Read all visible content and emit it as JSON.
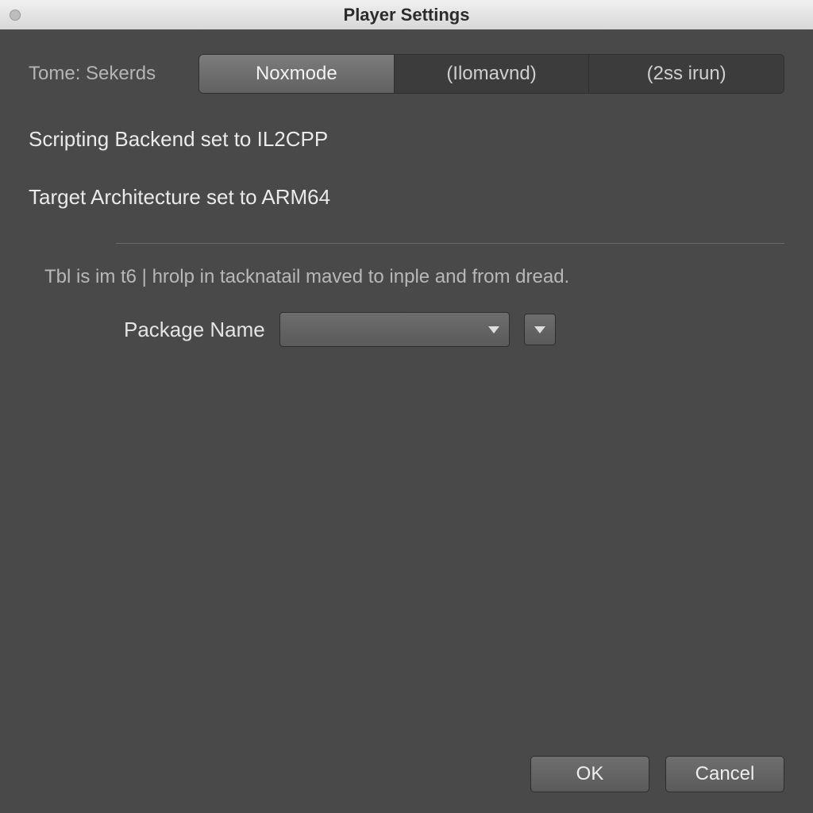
{
  "titlebar": {
    "title": "Player Settings"
  },
  "top": {
    "label": "Tome: Sekerds",
    "segments": [
      "Noxmode",
      "(Ilomavnd)",
      "(2ss irun)"
    ],
    "active_index": 0
  },
  "status": {
    "scripting": "Scripting Backend set  to IL2CPP",
    "architecture": "Target Architecture set to ARM64"
  },
  "helper_text": "Tbl is im t6 | hrolp in tacknatail maved to inple and from dread.",
  "package": {
    "label": "Package Name",
    "value": ""
  },
  "buttons": {
    "ok": "OK",
    "cancel": "Cancel"
  }
}
